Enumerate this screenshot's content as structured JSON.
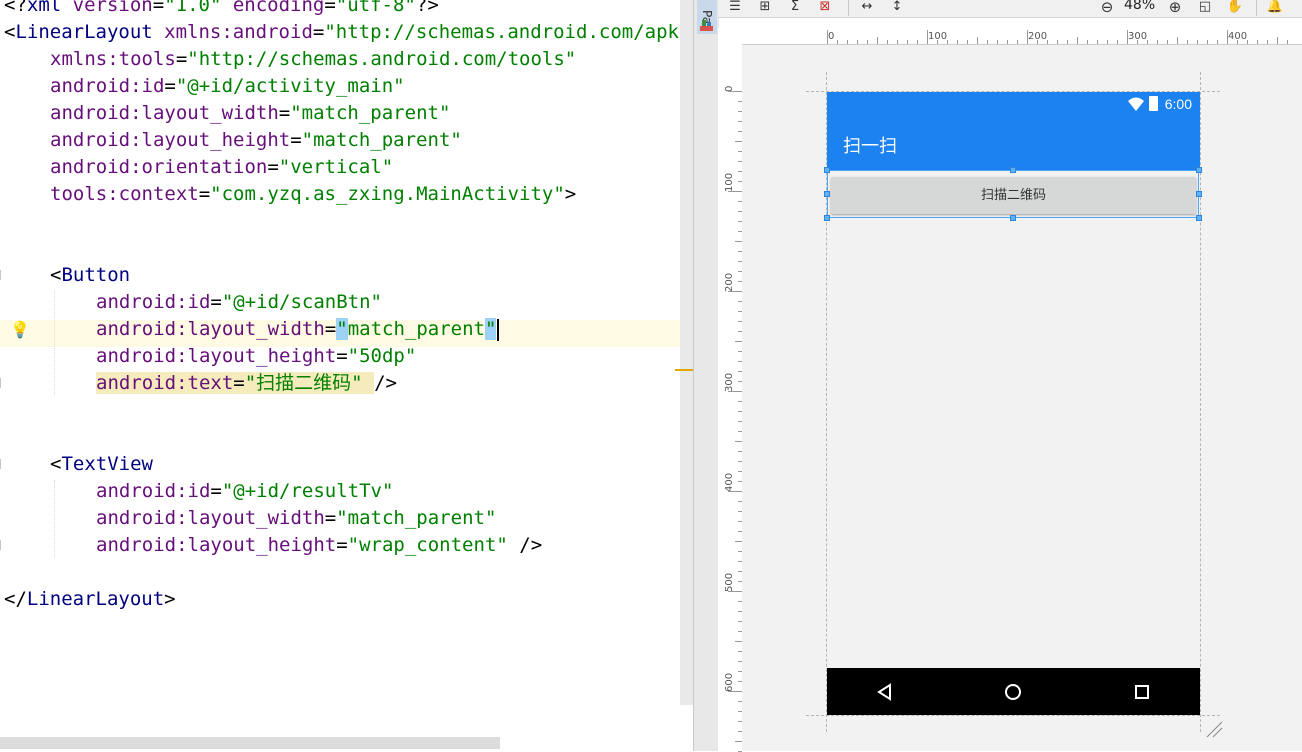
{
  "editor": {
    "lines": [
      {
        "indent": 0,
        "tokens": [
          [
            "punc",
            "<?"
          ],
          [
            "tag",
            "xml "
          ],
          [
            "attr",
            "version"
          ],
          [
            "punc",
            "="
          ],
          [
            "str",
            "\"1.0\""
          ],
          [
            "attr",
            " encoding"
          ],
          [
            "punc",
            "="
          ],
          [
            "str",
            "\"utf-8\""
          ],
          [
            "punc",
            "?>"
          ]
        ]
      },
      {
        "indent": 0,
        "tokens": [
          [
            "punc",
            "<"
          ],
          [
            "tag",
            "LinearLayout "
          ],
          [
            "attr",
            "xmlns:android"
          ],
          [
            "punc",
            "="
          ],
          [
            "str",
            "\"http://schemas.android.com/apk/res/android\""
          ]
        ]
      },
      {
        "indent": 4,
        "tokens": [
          [
            "attr",
            "xmlns:tools"
          ],
          [
            "punc",
            "="
          ],
          [
            "str",
            "\"http://schemas.android.com/tools\""
          ]
        ]
      },
      {
        "indent": 4,
        "tokens": [
          [
            "attr",
            "android:id"
          ],
          [
            "punc",
            "="
          ],
          [
            "str",
            "\"@+id/activity_main\""
          ]
        ]
      },
      {
        "indent": 4,
        "tokens": [
          [
            "attr",
            "android:layout_width"
          ],
          [
            "punc",
            "="
          ],
          [
            "str",
            "\"match_parent\""
          ]
        ]
      },
      {
        "indent": 4,
        "tokens": [
          [
            "attr",
            "android:layout_height"
          ],
          [
            "punc",
            "="
          ],
          [
            "str",
            "\"match_parent\""
          ]
        ]
      },
      {
        "indent": 4,
        "tokens": [
          [
            "attr",
            "android:orientation"
          ],
          [
            "punc",
            "="
          ],
          [
            "str",
            "\"vertical\""
          ]
        ]
      },
      {
        "indent": 4,
        "tokens": [
          [
            "attr",
            "tools:context"
          ],
          [
            "punc",
            "="
          ],
          [
            "str",
            "\"com.yzq.as_zxing.MainActivity\""
          ],
          [
            "punc",
            ">"
          ]
        ]
      },
      {
        "indent": 0,
        "tokens": []
      },
      {
        "indent": 0,
        "tokens": []
      },
      {
        "indent": 4,
        "tokens": [
          [
            "punc",
            "<"
          ],
          [
            "tag",
            "Button"
          ]
        ]
      },
      {
        "indent": 8,
        "tokens": [
          [
            "attr",
            "android:id"
          ],
          [
            "punc",
            "="
          ],
          [
            "str",
            "\"@+id/scanBtn\""
          ]
        ]
      },
      {
        "indent": 8,
        "tokens": [
          [
            "attr",
            "android:layout_width"
          ],
          [
            "punc",
            "="
          ],
          [
            "strhl",
            "\""
          ],
          [
            "str",
            "match_parent"
          ],
          [
            "strhl",
            "\""
          ],
          [
            "caret",
            ""
          ]
        ]
      },
      {
        "indent": 8,
        "tokens": [
          [
            "attr",
            "android:layout_height"
          ],
          [
            "punc",
            "="
          ],
          [
            "str",
            "\"50dp\""
          ]
        ]
      },
      {
        "indent": 8,
        "tokens": [
          [
            "attrhl",
            "android:text"
          ],
          [
            "punchl",
            "="
          ],
          [
            "strhl2",
            "\"扫描二维码\" "
          ],
          [
            "punc",
            "/>"
          ]
        ]
      },
      {
        "indent": 0,
        "tokens": []
      },
      {
        "indent": 0,
        "tokens": []
      },
      {
        "indent": 4,
        "tokens": [
          [
            "punc",
            "<"
          ],
          [
            "tag",
            "TextView"
          ]
        ]
      },
      {
        "indent": 8,
        "tokens": [
          [
            "attr",
            "android:id"
          ],
          [
            "punc",
            "="
          ],
          [
            "str",
            "\"@+id/resultTv\""
          ]
        ]
      },
      {
        "indent": 8,
        "tokens": [
          [
            "attr",
            "android:layout_width"
          ],
          [
            "punc",
            "="
          ],
          [
            "str",
            "\"match_parent\""
          ]
        ]
      },
      {
        "indent": 8,
        "tokens": [
          [
            "attr",
            "android:layout_height"
          ],
          [
            "punc",
            "="
          ],
          [
            "str",
            "\"wrap_content\""
          ],
          [
            "punc",
            " />"
          ]
        ]
      },
      {
        "indent": 0,
        "tokens": []
      },
      {
        "indent": 0,
        "tokens": [
          [
            "punc",
            "</"
          ],
          [
            "tag",
            "LinearLayout"
          ],
          [
            "punc",
            ">"
          ]
        ]
      }
    ]
  },
  "side": {
    "palette_tab": "Pa"
  },
  "toolbar": {
    "zoom": "48%"
  },
  "rulers": {
    "top": [
      "0",
      "100",
      "200",
      "300",
      "400"
    ],
    "left": [
      "0",
      "100",
      "200",
      "300",
      "400",
      "500",
      "600"
    ]
  },
  "device": {
    "status_time": "6:00",
    "app_title": "扫一扫",
    "button_text": "扫描二维码"
  },
  "colors": {
    "primary": "#1b82ef",
    "selection": "#4ea5f6",
    "navbar": "#000000"
  }
}
